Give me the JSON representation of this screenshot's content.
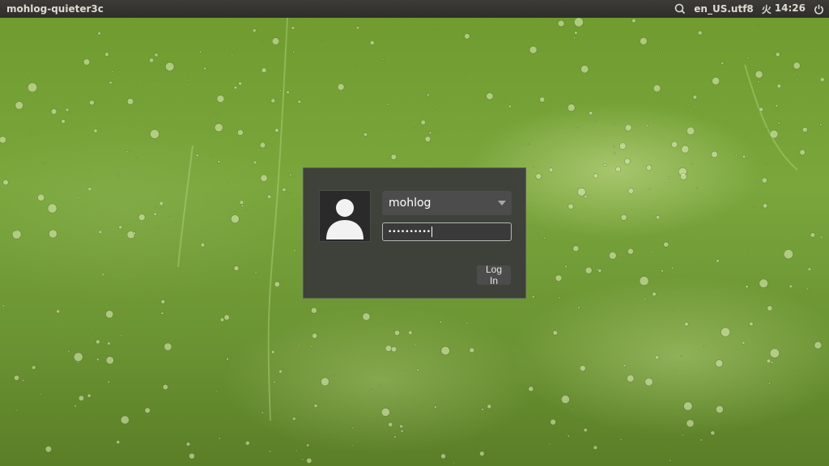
{
  "top_panel": {
    "hostname": "mohlog-quieter3c",
    "keyboard_layout": "en_US.utf8",
    "clock": {
      "day": "火",
      "time": "14:26"
    },
    "icons": [
      "accessibility-icon",
      "power-icon"
    ]
  },
  "login": {
    "username": "mohlog",
    "password_mask": "••••••••••",
    "login_button_label": "Log In"
  },
  "colors": {
    "panel": "#3c3b37",
    "panel_text": "#dfdbd2",
    "dialog_bg": "#3a3a3a",
    "wallpaper_green": "#6e9a2e"
  }
}
